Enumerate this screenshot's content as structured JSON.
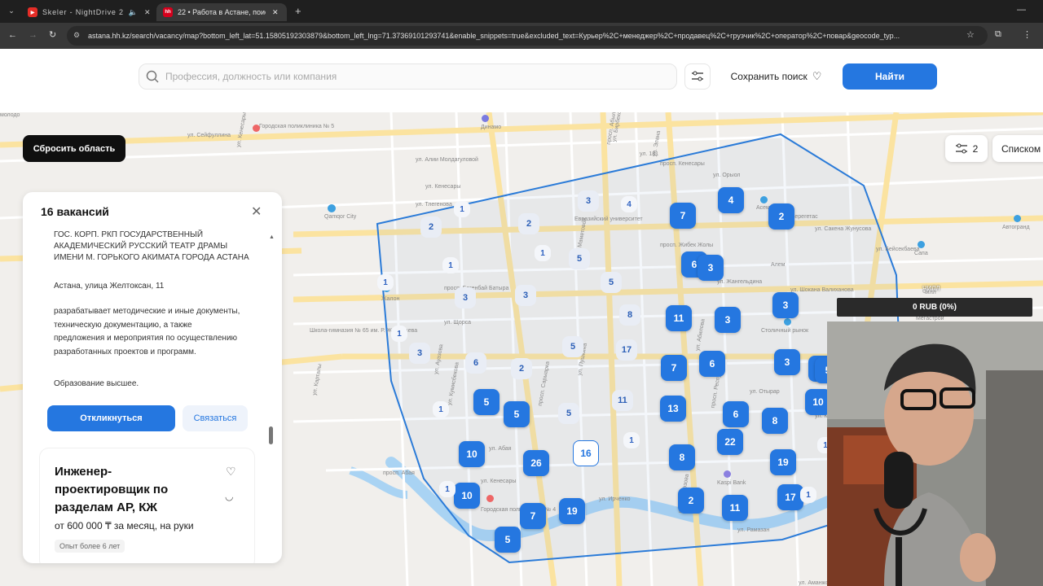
{
  "browser": {
    "tabs": [
      {
        "label": "Skeler - NightDrive 2",
        "active": false
      },
      {
        "label": "22 • Работа в Астане, поиск п",
        "active": true
      }
    ],
    "url": "astana.hh.kz/search/vacancy/map?bottom_left_lat=51.15805192303879&bottom_left_lng=71.37369101293741&enable_snippets=true&excluded_text=Курьер%2C+менеджер%2C+продавец%2C+грузчик%2C+оператор%2C+повар&geocode_typ..."
  },
  "header": {
    "search_placeholder": "Профессия, должность или компания",
    "save_search_label": "Сохранить поиск",
    "find_label": "Найти"
  },
  "map": {
    "reset_area_label": "Сбросить область",
    "filter_count": "2",
    "list_label": "Списком",
    "labels": [
      "Городская поликлиника № 5",
      "Динамо",
      "ул. Кенесары",
      "Qamqor City",
      "просп. Абылай хана",
      "Евразийский университет",
      "Асем",
      "Алем",
      "Сапа",
      "Автогранд",
      "Столичный рынок",
      "Мегастрой",
      "Школа-гимназия № 65 им. Р. Жумабаева",
      "Kaspi Bank",
      "Городская поликлиника № 4",
      "Жалон",
      "Чилл",
      "ул. Алии Молдагуловой",
      "ул. Кенесары",
      "просп. Жибек Жолы",
      "ул. Жангельдина",
      "ул. Шокана Валиханова",
      "ул. Орыол",
      "ул. Сакена Жунусова",
      "ул. Бейсекбаева",
      "ул. Отырар",
      "просп. Богенбай Батыра",
      "ул. Кенесары",
      "ул. Абая",
      "ул. Ирченко",
      "ул. Рамазан",
      "ул. Кравцова",
      "просп. Республики",
      "просп. Сарыарка",
      "ул. Ауэзова",
      "ул. Кумисбекова",
      "ул. Щорса",
      "просп. Абая",
      "ул. Пушкина",
      "ул. Бирбекова",
      "ул. Элана",
      "ул. Тлегенова",
      "ул. Маметовой",
      "просп. Кенесары",
      "ул. 181",
      "ул. Керегетас",
      "ул. Абилова",
      "ул. Сейфуллина",
      "ул. Карталы",
      "просп. Ауэзова",
      "ул. Аманжолова",
      "молодо"
    ],
    "clusters": [
      "2",
      "4",
      "1",
      "2",
      "3",
      "7",
      "4",
      "2",
      "1",
      "1",
      "5",
      "5",
      "6",
      "3",
      "1",
      "3",
      "3",
      "8",
      "11",
      "3",
      "3",
      "1",
      "3",
      "17",
      "5",
      "6",
      "7",
      "3",
      "5",
      "2",
      "6",
      "5",
      "11",
      "13",
      "6",
      "8",
      "5",
      "10",
      "1",
      "1",
      "16",
      "1",
      "8",
      "22",
      "19",
      "10",
      "26",
      "10",
      "7",
      "19",
      "5",
      "2",
      "11",
      "17",
      "1",
      "1",
      "5",
      "5"
    ]
  },
  "panel": {
    "title": "16 вакансий",
    "company": "ГОС. КОРП. РКП ГОСУДАРСТВЕННЫЙ АКАДЕМИЧЕСКИЙ РУССКИЙ ТЕАТР ДРАМЫ ИМЕНИ М. ГОРЬКОГО АКИМАТА ГОРОДА АСТАНА",
    "address": "Астана, улица Желтоксан, 11",
    "description": "разрабатывает методические и иные документы, техническую документацию, а также предложения и мероприятия по осуществлению разработанных проектов и программ.",
    "education": "Образование высшее.",
    "apply_label": "Откликнуться",
    "contact_label": "Связаться",
    "vacancy2_title": "Инженер-проектировщик по разделам АР, КЖ",
    "vacancy2_salary": "от 600 000 ₸ за месяц, на руки",
    "vacancy2_exp": "Опыт более 6 лет"
  },
  "overlay": {
    "rub_label": "0 RUB (0%)",
    "chill_label": "ЧИЛЛ"
  }
}
